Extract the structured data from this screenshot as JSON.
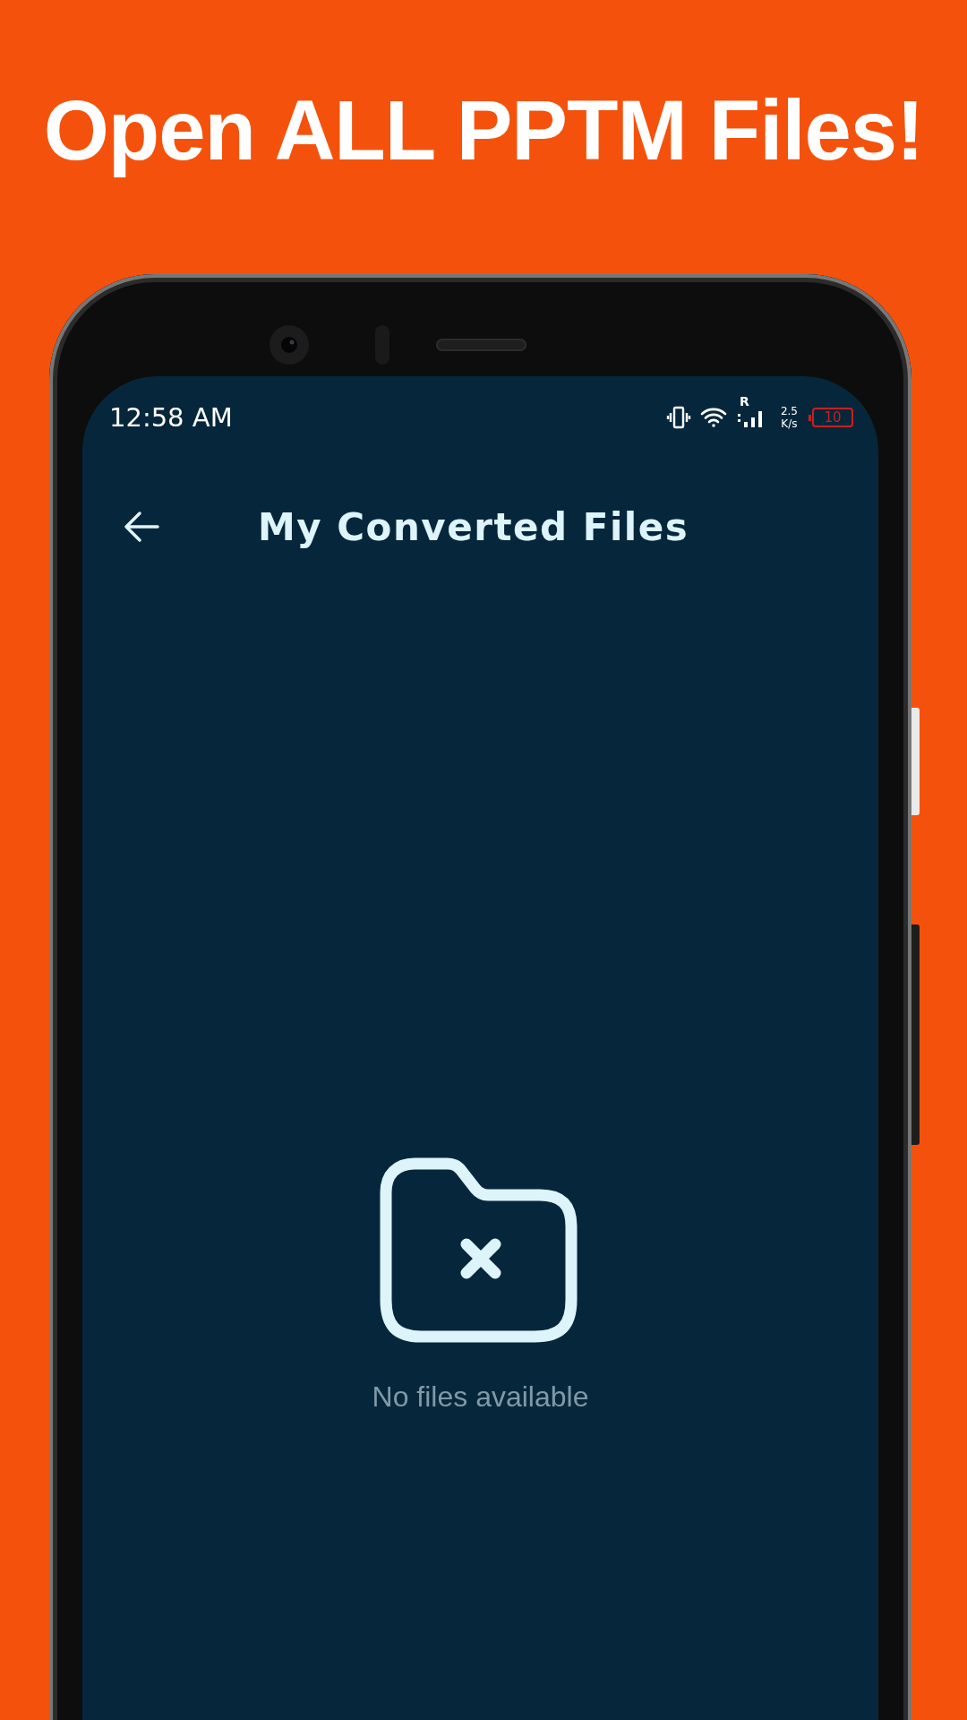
{
  "headline": "Open ALL PPTM Files!",
  "status_bar": {
    "time": "12:58 AM",
    "network_badge": "R",
    "speed_value": "2.5",
    "speed_unit": "K/s",
    "battery": "10"
  },
  "app_bar": {
    "title": "My Converted Files"
  },
  "empty_state": {
    "message": "No files available"
  }
}
